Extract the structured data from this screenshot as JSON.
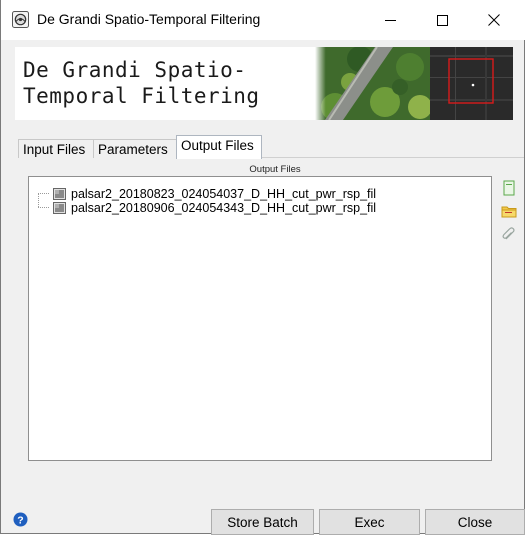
{
  "window": {
    "title": "De Grandi Spatio-Temporal Filtering",
    "app_icon": "gear-globe-icon",
    "controls": {
      "minimize": "minimize-icon",
      "maximize": "maximize-icon",
      "close": "close-icon"
    }
  },
  "banner": {
    "title": "De Grandi Spatio-Temporal Filtering",
    "image": "forest-road-radar-image"
  },
  "tabs": [
    {
      "label": "Input Files",
      "active": false
    },
    {
      "label": "Parameters",
      "active": false
    },
    {
      "label": "Output Files",
      "active": true
    }
  ],
  "output_files": {
    "header": "Output Files",
    "items": [
      "palsar2_20180823_024054037_D_HH_cut_pwr_rsp_fil",
      "palsar2_20180906_024054343_D_HH_cut_pwr_rsp_fil"
    ],
    "side_buttons": [
      "new-file-icon",
      "open-folder-icon",
      "attach-icon"
    ]
  },
  "footer": {
    "help_icon": "help-icon",
    "store_batch": "Store Batch",
    "exec": "Exec",
    "close": "Close"
  },
  "colors": {
    "help": "#1f5fbf",
    "folder": "#e8b520",
    "file_icon": "#6bbf59"
  }
}
